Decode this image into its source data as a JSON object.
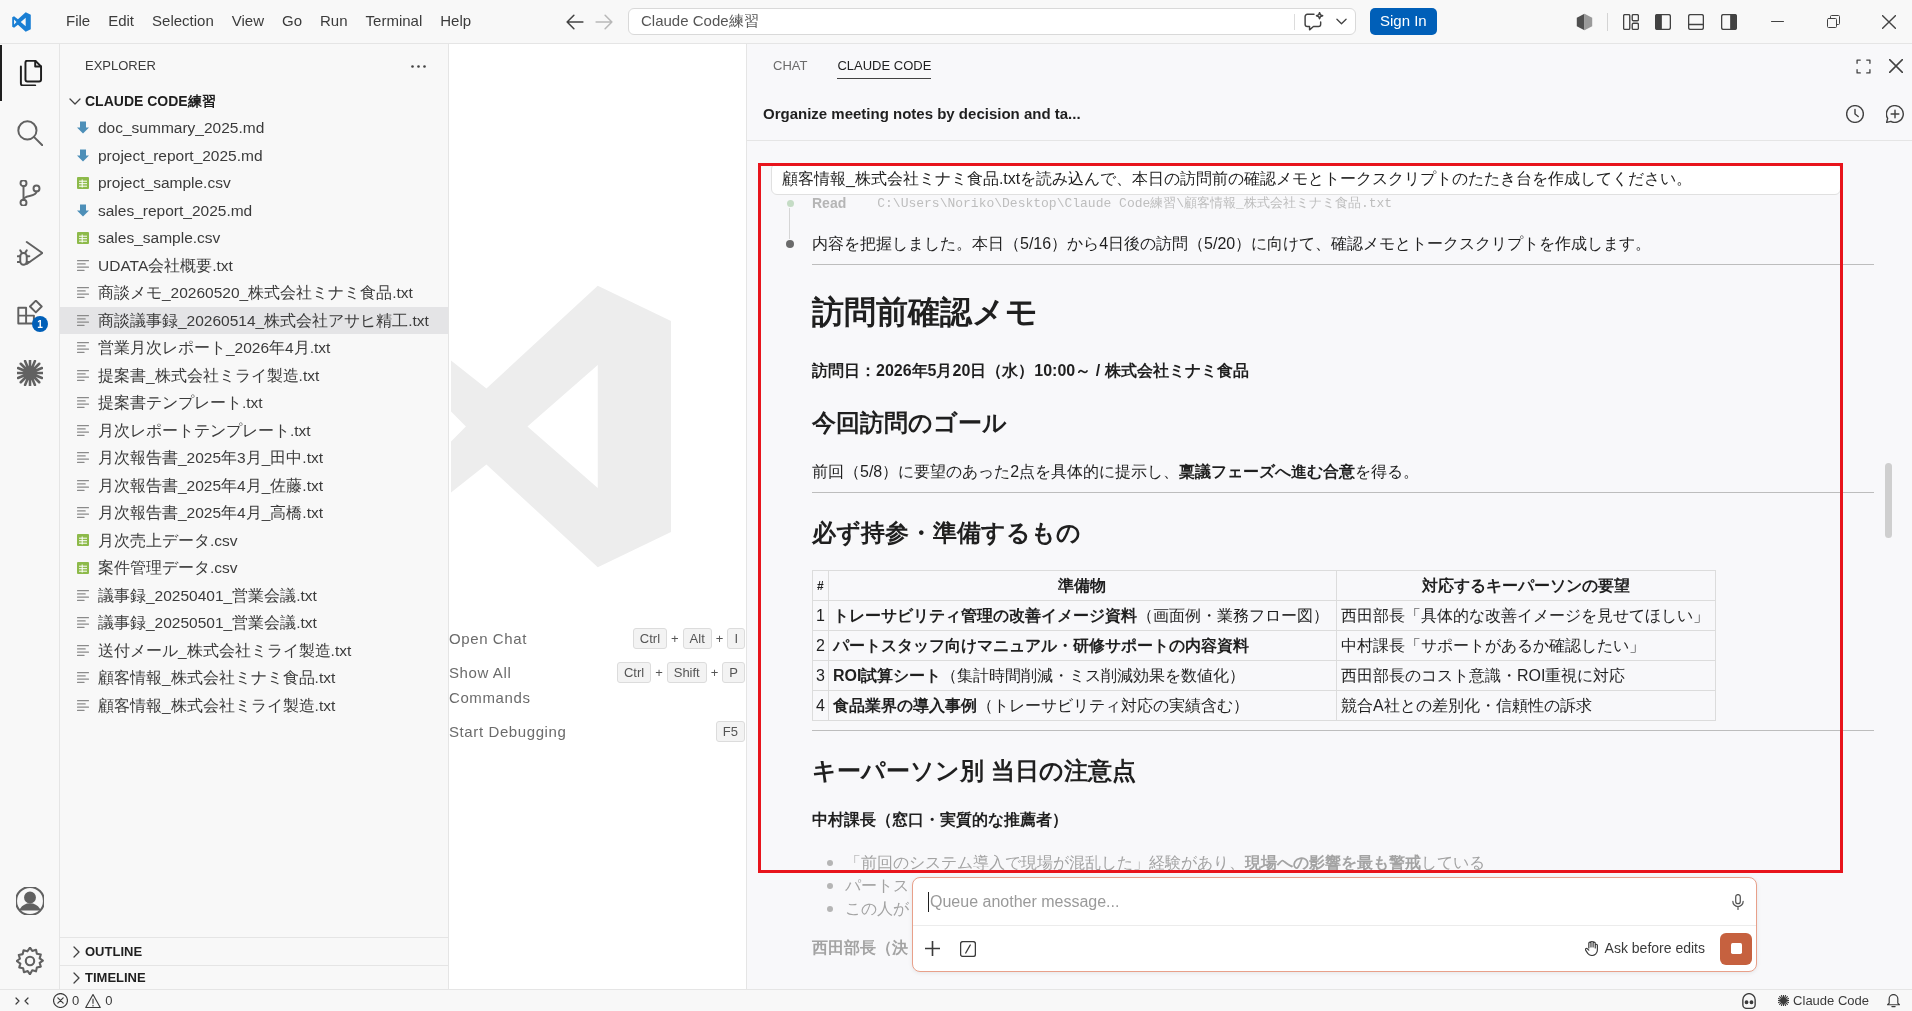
{
  "title_bar": {
    "menu": [
      "File",
      "Edit",
      "Selection",
      "View",
      "Go",
      "Run",
      "Terminal",
      "Help"
    ],
    "nav": [
      {
        "kind": "back",
        "disabled": false
      },
      {
        "kind": "forward",
        "disabled": true
      }
    ],
    "search": {
      "value": "Claude Code練習"
    },
    "sign_in": "Sign In"
  },
  "activity_bar": {
    "items": [
      {
        "kind": "explorer",
        "selected": true
      },
      {
        "kind": "search",
        "selected": false
      },
      {
        "kind": "source_control",
        "selected": false
      },
      {
        "kind": "run_debug",
        "selected": false
      },
      {
        "kind": "extensions",
        "selected": false,
        "badge": "1"
      },
      {
        "kind": "claude",
        "selected": false
      }
    ],
    "bottom": [
      {
        "kind": "account"
      },
      {
        "kind": "settings"
      }
    ]
  },
  "explorer": {
    "title": "EXPLORER",
    "folder": {
      "name": "CLAUDE CODE練習",
      "expanded": true,
      "files": [
        {
          "name": "doc_summary_2025.md",
          "kind": "md",
          "selected": false
        },
        {
          "name": "project_report_2025.md",
          "kind": "md",
          "selected": false
        },
        {
          "name": "project_sample.csv",
          "kind": "csv",
          "selected": false
        },
        {
          "name": "sales_report_2025.md",
          "kind": "md",
          "selected": false
        },
        {
          "name": "sales_sample.csv",
          "kind": "csv",
          "selected": false
        },
        {
          "name": "UDATA会社概要.txt",
          "kind": "txt",
          "selected": false
        },
        {
          "name": "商談メモ_20260520_株式会社ミナミ食品.txt",
          "kind": "txt",
          "selected": false
        },
        {
          "name": "商談議事録_20260514_株式会社アサヒ精工.txt",
          "kind": "txt",
          "selected": true
        },
        {
          "name": "営業月次レポート_2026年4月.txt",
          "kind": "txt",
          "selected": false
        },
        {
          "name": "提案書_株式会社ミライ製造.txt",
          "kind": "txt",
          "selected": false
        },
        {
          "name": "提案書テンプレート.txt",
          "kind": "txt",
          "selected": false
        },
        {
          "name": "月次レポートテンプレート.txt",
          "kind": "txt",
          "selected": false
        },
        {
          "name": "月次報告書_2025年3月_田中.txt",
          "kind": "txt",
          "selected": false
        },
        {
          "name": "月次報告書_2025年4月_佐藤.txt",
          "kind": "txt",
          "selected": false
        },
        {
          "name": "月次報告書_2025年4月_高橋.txt",
          "kind": "txt",
          "selected": false
        },
        {
          "name": "月次売上データ.csv",
          "kind": "csv",
          "selected": false
        },
        {
          "name": "案件管理データ.csv",
          "kind": "csv",
          "selected": false
        },
        {
          "name": "議事録_20250401_営業会議.txt",
          "kind": "txt",
          "selected": false
        },
        {
          "name": "議事録_20250501_営業会議.txt",
          "kind": "txt",
          "selected": false
        },
        {
          "name": "送付メール_株式会社ミライ製造.txt",
          "kind": "txt",
          "selected": false
        },
        {
          "name": "顧客情報_株式会社ミナミ食品.txt",
          "kind": "txt",
          "selected": false
        },
        {
          "name": "顧客情報_株式会社ミライ製造.txt",
          "kind": "txt",
          "selected": false
        }
      ]
    },
    "sections": [
      {
        "label": "OUTLINE",
        "expanded": false
      },
      {
        "label": "TIMELINE",
        "expanded": false
      }
    ]
  },
  "editor": {
    "commands": [
      {
        "label": "Open Chat",
        "shortcut": [
          {
            "kind": "key",
            "text": "Ctrl"
          },
          {
            "kind": "plus",
            "text": "+"
          },
          {
            "kind": "key",
            "text": "Alt"
          },
          {
            "kind": "plus",
            "text": "+"
          },
          {
            "kind": "key",
            "text": "I"
          }
        ]
      },
      {
        "label": "Show All Commands",
        "shortcut": [
          {
            "kind": "key",
            "text": "Ctrl"
          },
          {
            "kind": "plus",
            "text": "+"
          },
          {
            "kind": "key",
            "text": "Shift"
          },
          {
            "kind": "plus",
            "text": "+"
          },
          {
            "kind": "key",
            "text": "P"
          }
        ]
      },
      {
        "label": "Start Debugging",
        "shortcut": [
          {
            "kind": "key",
            "text": "F5"
          }
        ]
      }
    ]
  },
  "chat": {
    "tabs": [
      {
        "label": "CHAT",
        "selected": false
      },
      {
        "label": "CLAUDE CODE",
        "selected": true
      }
    ],
    "session_title": "Organize meeting notes by decision and ta...",
    "user_message": "顧客情報_株式会社ミナミ食品.txtを読み込んで、本日の訪問前の確認メモとトークスクリプトのたたき台を作成してください。",
    "tool_step": {
      "label": "Read",
      "path": "C:\\Users\\Noriko\\Desktop\\Claude Code練習\\顧客情報_株式会社ミナミ食品.txt"
    },
    "reply_intro": "内容を把握しました。本日（5/16）から4日後の訪問（5/20）に向けて、確認メモとトークスクリプトを作成します。",
    "blocks": [
      {
        "kind": "rule",
        "faded": false
      },
      {
        "kind": "h1",
        "text": "訪問前確認メモ",
        "faded": false
      },
      {
        "kind": "strong",
        "text": "訪問日：2026年5月20日（水）10:00～ / 株式会社ミナミ食品",
        "faded": false
      },
      {
        "kind": "h2",
        "text": "今回訪問のゴール",
        "faded": false
      },
      {
        "kind": "p",
        "text": "前回（5/8）に要望のあった2点を具体的に提示し、**稟議フェーズへ進む合意**を得る。",
        "faded": false
      },
      {
        "kind": "rule",
        "faded": false
      },
      {
        "kind": "h2",
        "text": "必ず持参・準備するもの",
        "faded": false
      },
      {
        "kind": "table",
        "faded": false,
        "columns": [
          "#",
          "準備物",
          "対応するキーパーソンの要望"
        ],
        "rows": [
          {
            "no": "1",
            "item": "**トレーサビリティ管理の改善イメージ資料**（画面例・業務フロー図）",
            "item_bold": false,
            "request": "西田部長「具体的な改善イメージを見せてほしい」"
          },
          {
            "no": "2",
            "item": "パートスタッフ向けマニュアル・研修サポートの内容資料",
            "item_bold": true,
            "request": "中村課長「サポートがあるか確認したい」"
          },
          {
            "no": "3",
            "item": "**ROI試算シート**（集計時間削減・ミス削減効果を数値化）",
            "item_bold": false,
            "request": "西田部長のコスト意識・ROI重視に対応"
          },
          {
            "no": "4",
            "item": "**食品業界の導入事例**（トレーサビリティ対応の実績含む）",
            "item_bold": false,
            "request": "競合A社との差別化・信頼性の訴求"
          }
        ]
      },
      {
        "kind": "rule",
        "faded": false
      },
      {
        "kind": "h2",
        "text": "キーパーソン別 当日の注意点",
        "faded": false
      },
      {
        "kind": "strong",
        "text": "中村課長（窓口・実質的な推薦者）",
        "faded": false
      },
      {
        "kind": "bullets",
        "faded": true,
        "items": [
          "「前回のシステム導入で現場が混乱した」経験があり、**現場への影響を最も警戒**している",
          "パートス",
          "この人が"
        ]
      },
      {
        "kind": "strong",
        "text": "西田部長（決",
        "faded": true
      }
    ],
    "composer": {
      "placeholder": "Queue another message...",
      "mode": "Ask before edits"
    }
  },
  "status_bar": {
    "errors": "0",
    "warnings": "0",
    "label": "Claude Code"
  },
  "annotations": [
    {
      "kind": "rectangle"
    }
  ]
}
